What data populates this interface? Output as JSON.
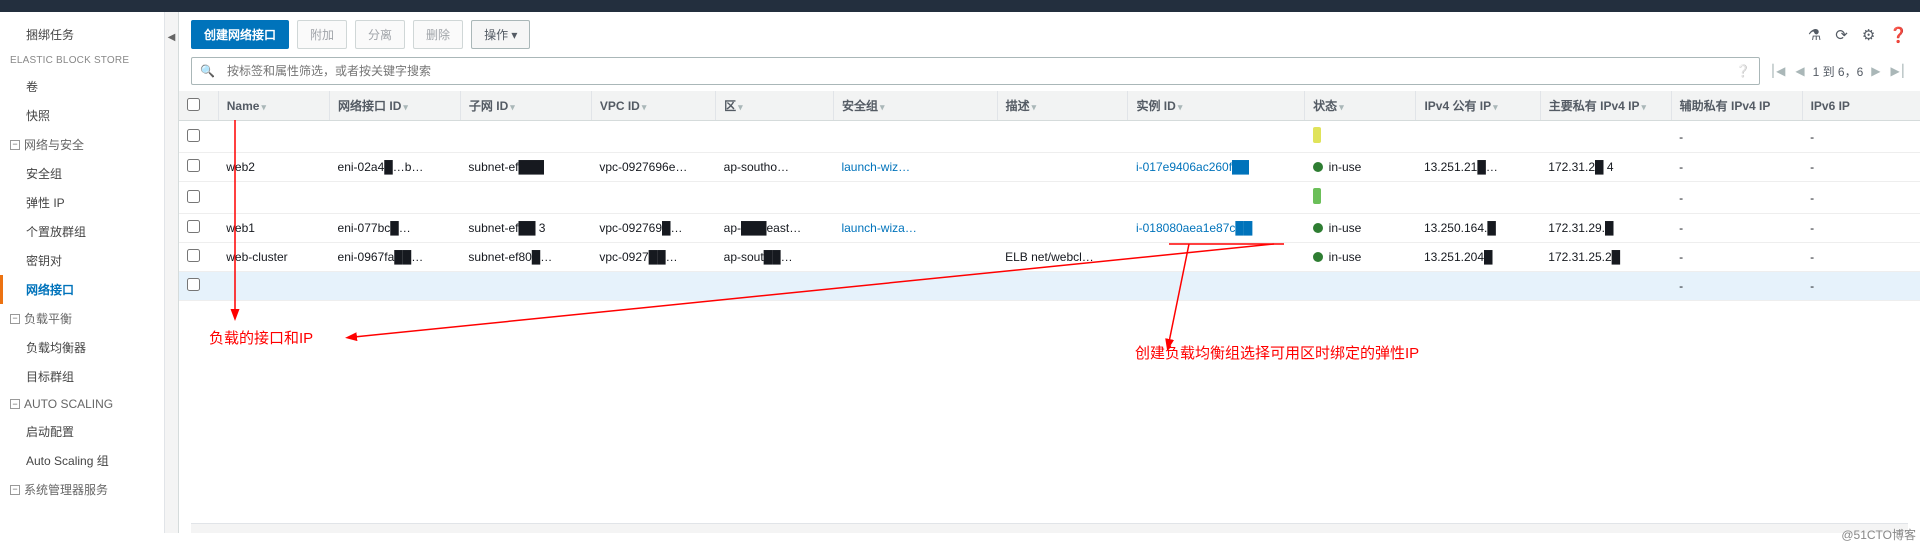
{
  "sidebar": {
    "items": [
      {
        "type": "item",
        "label": "捆绑任务"
      },
      {
        "type": "group-static",
        "label": "ELASTIC BLOCK STORE"
      },
      {
        "type": "child",
        "label": "卷"
      },
      {
        "type": "child",
        "label": "快照"
      },
      {
        "type": "group",
        "label": "网络与安全",
        "open": true
      },
      {
        "type": "child",
        "label": "安全组"
      },
      {
        "type": "child",
        "label": "弹性 IP"
      },
      {
        "type": "child",
        "label": "个置放群组"
      },
      {
        "type": "child",
        "label": "密钥对"
      },
      {
        "type": "child",
        "label": "网络接口",
        "active": true
      },
      {
        "type": "group",
        "label": "负载平衡",
        "open": true
      },
      {
        "type": "child",
        "label": "负载均衡器"
      },
      {
        "type": "child",
        "label": "目标群组"
      },
      {
        "type": "group",
        "label": "AUTO SCALING",
        "open": true
      },
      {
        "type": "child",
        "label": "启动配置"
      },
      {
        "type": "child",
        "label": "Auto Scaling 组"
      },
      {
        "type": "group",
        "label": "系统管理器服务",
        "open": true
      }
    ]
  },
  "toolbar": {
    "create": "创建网络接口",
    "attach": "附加",
    "detach": "分离",
    "delete": "删除",
    "actions": "操作"
  },
  "search": {
    "placeholder": "按标签和属性筛选，或者按关键字搜索",
    "page_info": "1 到 6，6"
  },
  "columns": {
    "name": "Name",
    "eni": "网络接口 ID",
    "subnet": "子网 ID",
    "vpc": "VPC ID",
    "zone": "区",
    "sg": "安全组",
    "desc": "描述",
    "instance": "实例 ID",
    "state": "状态",
    "pubip": "IPv4 公有 IP",
    "privip": "主要私有 IPv4 IP",
    "secip": "辅助私有 IPv4 IP",
    "ip6": "IPv6 IP"
  },
  "rows": [
    {
      "name": "",
      "eni": "",
      "subnet": "",
      "vpc": "",
      "zone": "",
      "sg": "",
      "desc": "",
      "instance": "",
      "state": "",
      "pubip": "",
      "privip": "",
      "secip": "-",
      "ip6": "-",
      "pill": "y"
    },
    {
      "name": "web2",
      "eni": "eni-02a4█…b…",
      "subnet": "subnet-ef███",
      "vpc": "vpc-0927696e…",
      "zone": "ap-southo…",
      "sg": "launch-wiz…",
      "sg_link": true,
      "desc": "",
      "instance": "i-017e9406ac260f██",
      "instance_link": true,
      "state": "in-use",
      "pubip": "13.251.21█…",
      "privip": "172.31.2█ 4",
      "secip": "-",
      "ip6": "-",
      "dot": true
    },
    {
      "name": "",
      "eni": "",
      "subnet": "",
      "vpc": "",
      "zone": "",
      "sg": "",
      "desc": "",
      "instance": "",
      "state": "",
      "pubip": "",
      "privip": "",
      "secip": "-",
      "ip6": "-",
      "pill": "g"
    },
    {
      "name": "web1",
      "eni": "eni-077bc█…",
      "subnet": "subnet-ef██ 3",
      "vpc": "vpc-092769█…",
      "zone": "ap-███east…",
      "sg": "launch-wiza…",
      "sg_link": true,
      "desc": "",
      "instance": "i-018080aea1e87c██",
      "instance_link": true,
      "state": "in-use",
      "pubip": "13.250.164.█",
      "privip": "172.31.29.█",
      "secip": "-",
      "ip6": "-",
      "dot": true
    },
    {
      "name": "web-cluster",
      "eni": "eni-0967fa██…",
      "subnet": "subnet-ef80█…",
      "vpc": "vpc-0927██…",
      "zone": "ap-sout██…",
      "sg": "",
      "desc": "ELB net/webcl…",
      "instance": "",
      "state": "in-use",
      "pubip": "13.251.204█",
      "privip": "172.31.25.2█",
      "secip": "-",
      "ip6": "-",
      "dot": true
    },
    {
      "name": "",
      "eni": "",
      "subnet": "",
      "vpc": "",
      "zone": "",
      "sg": "",
      "desc": "",
      "instance": "",
      "state": "",
      "pubip": "",
      "privip": "",
      "secip": "-",
      "ip6": "-",
      "selected": true
    }
  ],
  "annotations": {
    "left": "负载的接口和IP",
    "right": "创建负载均衡组选择可用区时绑定的弹性IP"
  },
  "watermark": "@51CTO博客"
}
